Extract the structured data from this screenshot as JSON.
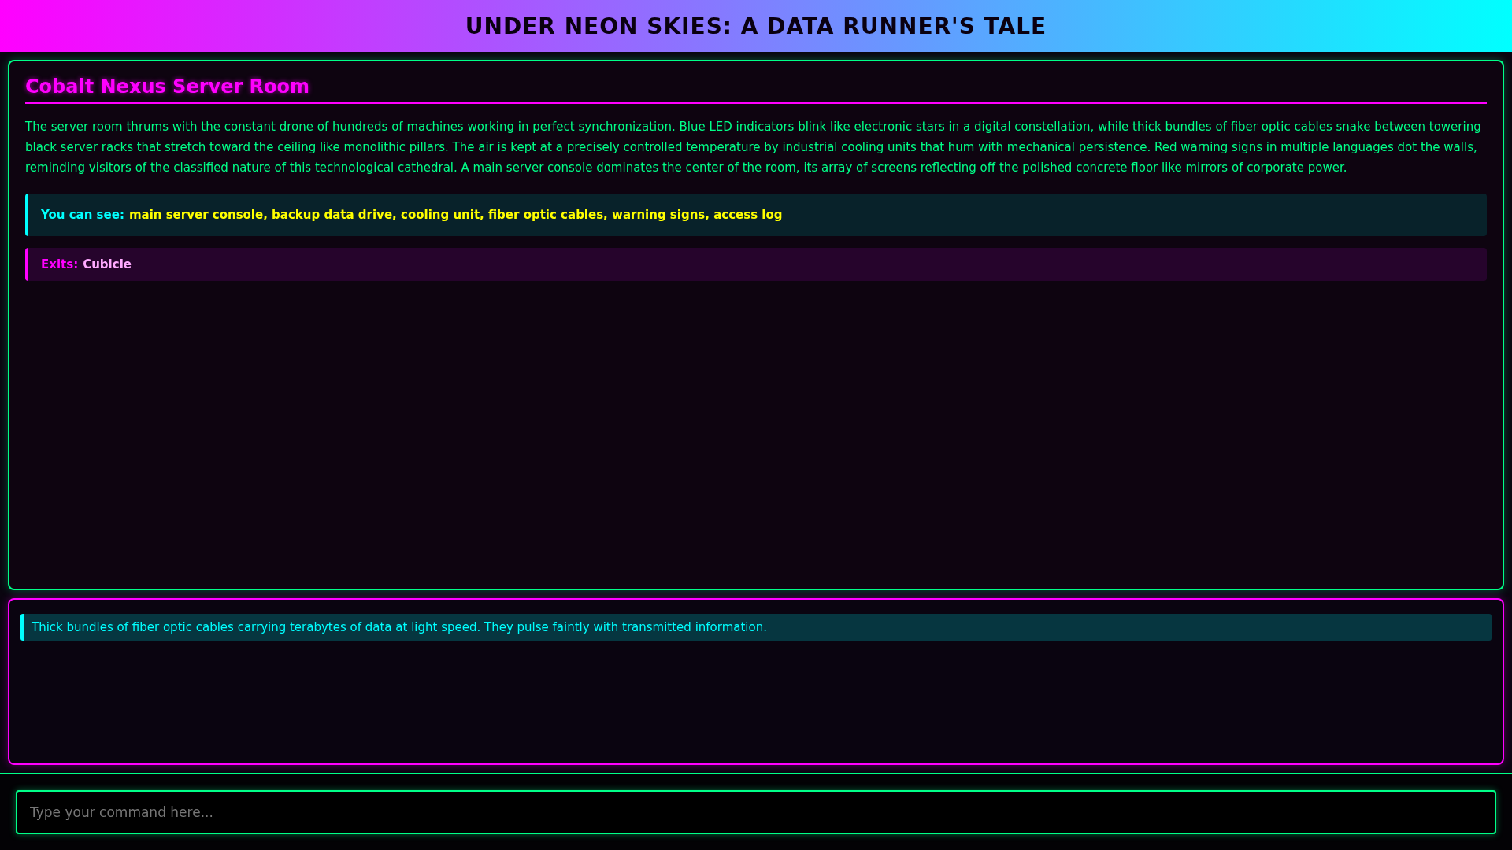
{
  "header": {
    "title": "UNDER NEON SKIES: A DATA RUNNER'S TALE"
  },
  "room": {
    "name": "Cobalt Nexus Server Room",
    "description": "The server room thrums with the constant drone of hundreds of machines working in perfect synchronization. Blue LED indicators blink like electronic stars in a digital constellation, while thick bundles of fiber optic cables snake between towering black server racks that stretch toward the ceiling like monolithic pillars. The air is kept at a precisely controlled temperature by industrial cooling units that hum with mechanical persistence. Red warning signs in multiple languages dot the walls, reminding visitors of the classified nature of this technological cathedral. A main server console dominates the center of the room, its array of screens reflecting off the polished concrete floor like mirrors of corporate power.",
    "sections": [
      {
        "kind": "items",
        "label": "You can see:",
        "value": "main server console, backup data drive, cooling unit, fiber optic cables, warning signs, access log"
      },
      {
        "kind": "exits",
        "label": "Exits:",
        "value": "Cubicle"
      }
    ]
  },
  "messages": [
    {
      "text": "Thick bundles of fiber optic cables carrying terabytes of data at light speed. They pulse faintly with transmitted information."
    }
  ],
  "command": {
    "placeholder": "Type your command here..."
  }
}
